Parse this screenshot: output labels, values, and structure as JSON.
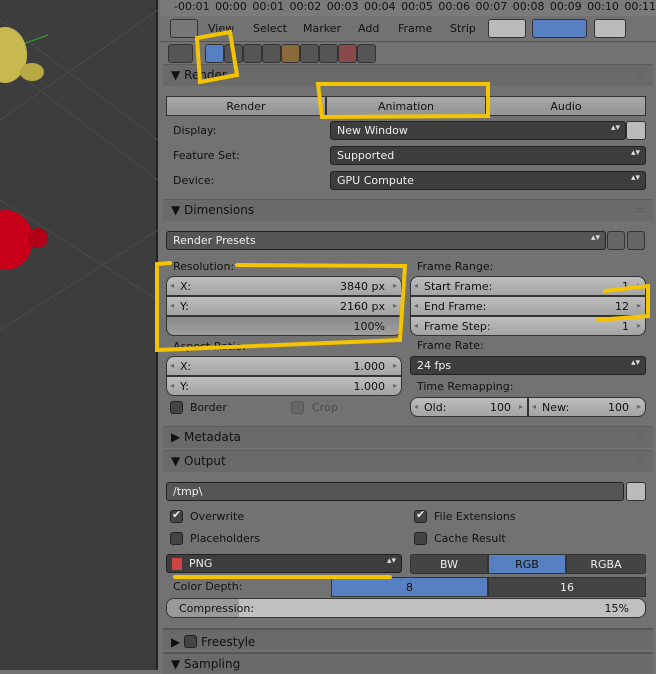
{
  "timeline": {
    "ruler": "-00:01 00:00 00:01 00:02 00:03 00:04 00:05 00:06 00:07 00:08 00:09 00:10 00:11"
  },
  "header": {
    "menus": [
      "View",
      "Select",
      "Marker",
      "Add",
      "Frame",
      "Strip"
    ]
  },
  "render": {
    "title": "Render",
    "buttons": [
      "Render",
      "Animation",
      "Audio"
    ],
    "display_label": "Display:",
    "display": "New Window",
    "feature_label": "Feature Set:",
    "feature": "Supported",
    "device_label": "Device:",
    "device": "GPU Compute"
  },
  "dimensions": {
    "title": "Dimensions",
    "presets": "Render Presets",
    "resolution_label": "Resolution:",
    "res_x_label": "X:",
    "res_x": "3840 px",
    "res_y_label": "Y:",
    "res_y": "2160 px",
    "res_pct": "100%",
    "aspect_label": "Aspect Ratio:",
    "asp_x_label": "X:",
    "asp_x": "1.000",
    "asp_y_label": "Y:",
    "asp_y": "1.000",
    "border": "Border",
    "crop": "Crop",
    "frame_range_label": "Frame Range:",
    "start_label": "Start Frame:",
    "start": "1",
    "end_label": "End Frame:",
    "end": "12",
    "step_label": "Frame Step:",
    "step": "1",
    "frame_rate_label": "Frame Rate:",
    "frame_rate": "24 fps",
    "remap_label": "Time Remapping:",
    "old_label": "Old:",
    "old": "100",
    "new_label": "New:",
    "new": "100"
  },
  "metadata": {
    "title": "Metadata"
  },
  "output": {
    "title": "Output",
    "path": "/tmp\\",
    "overwrite": "Overwrite",
    "file_ext": "File Extensions",
    "placeholders": "Placeholders",
    "cache": "Cache Result",
    "format": "PNG",
    "color_modes": [
      "BW",
      "RGB",
      "RGBA"
    ],
    "color_depth_label": "Color Depth:",
    "depths": [
      "8",
      "16"
    ],
    "compression_label": "Compression:",
    "compression": "15%",
    "compression_value": 15
  },
  "freestyle": {
    "title": "Freestyle"
  },
  "sampling": {
    "title": "Sampling"
  },
  "colors": {
    "accent": "#5680c2",
    "annotation": "#f5c400"
  }
}
